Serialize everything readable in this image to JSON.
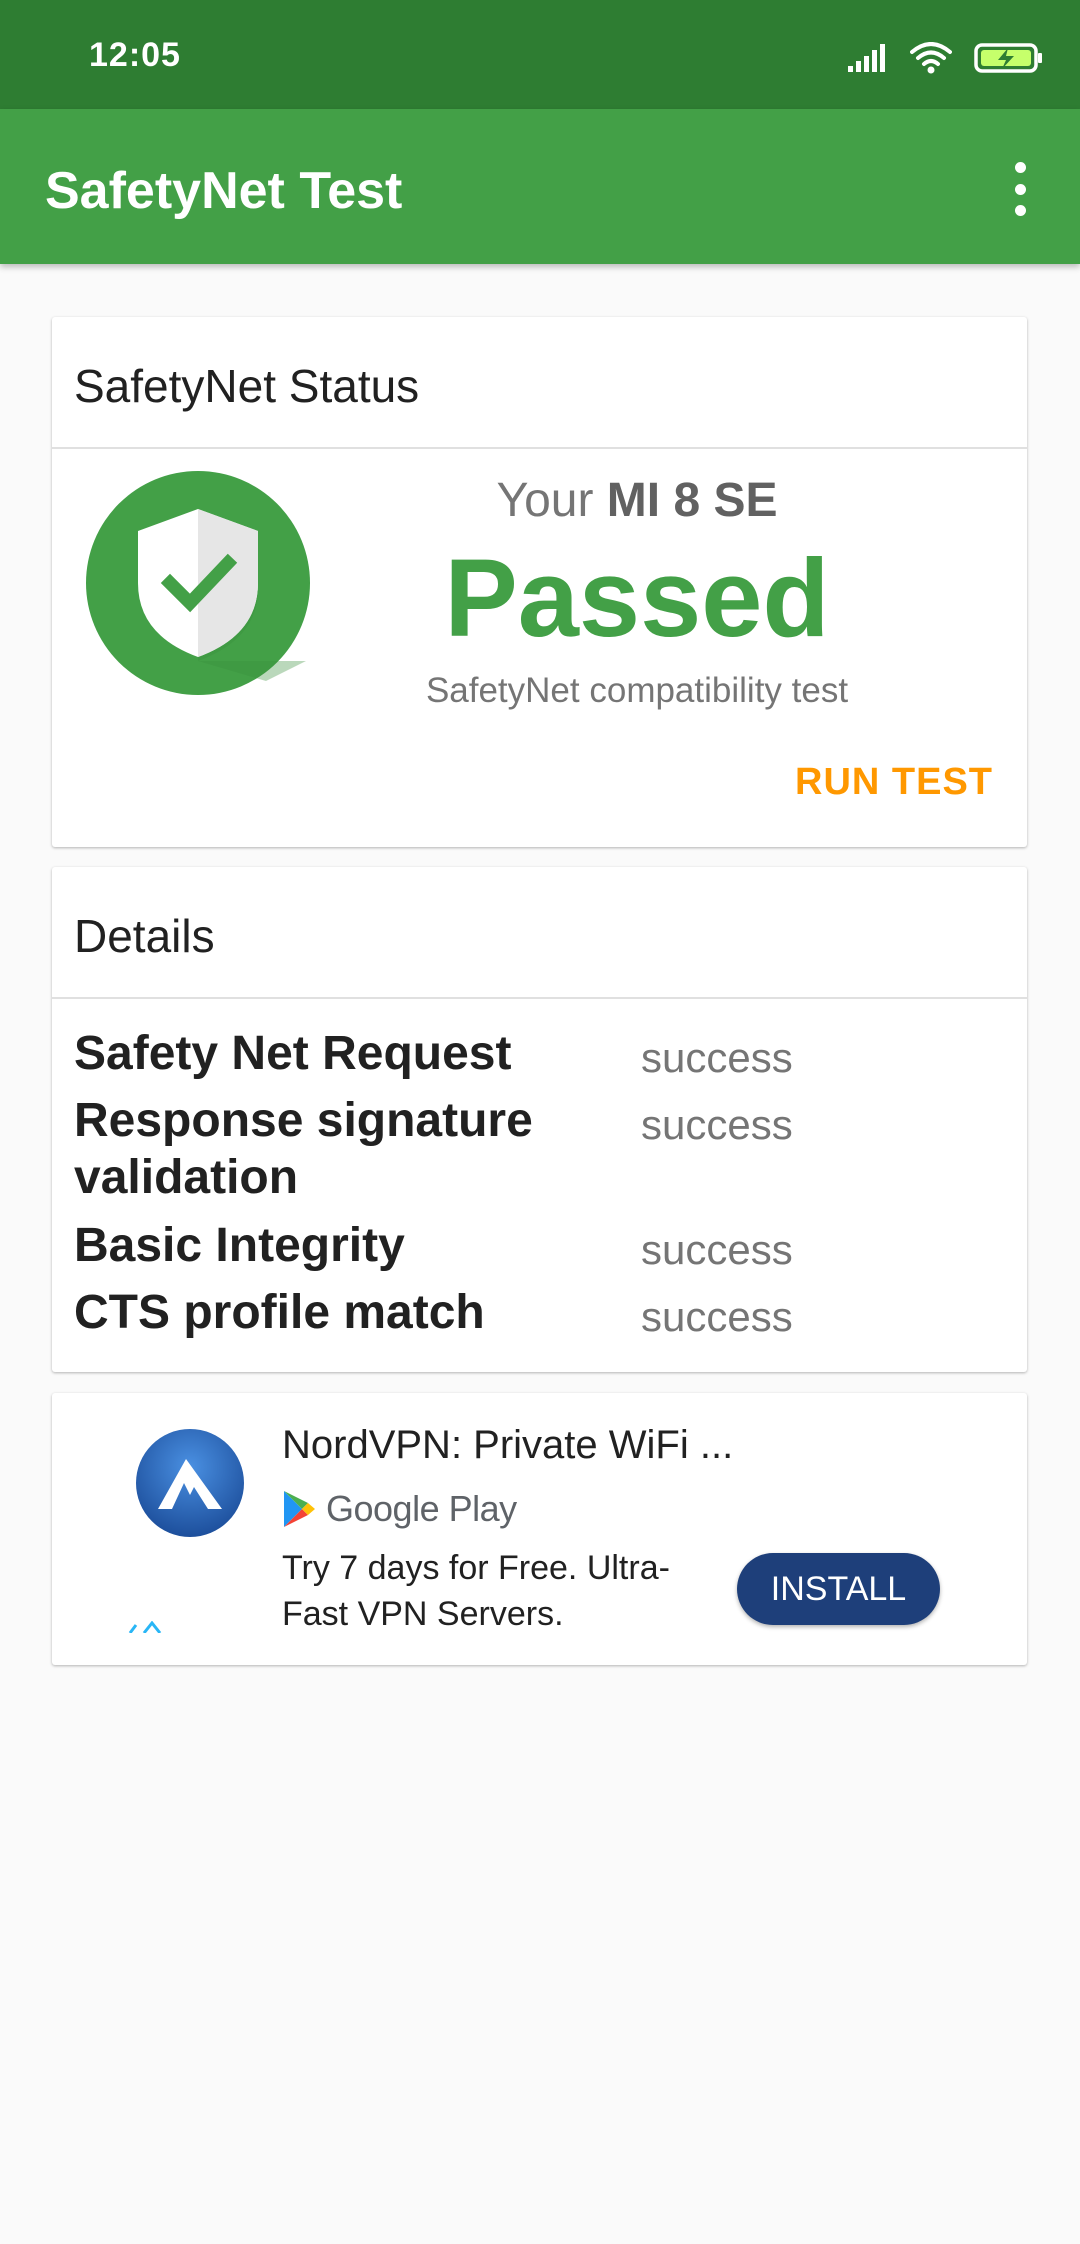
{
  "status_bar": {
    "time": "12:05",
    "icons": [
      "signal-icon",
      "wifi-icon",
      "battery-charging-icon"
    ]
  },
  "app_bar": {
    "title": "SafetyNet Test",
    "menu_icon": "more-vert-icon"
  },
  "status_card": {
    "header": "SafetyNet Status",
    "device_prefix": "Your",
    "device_name": "MI 8 SE",
    "result": "Passed",
    "subtitle": "SafetyNet compatibility test",
    "action_label": "RUN TEST",
    "icon": "shield-check-icon"
  },
  "details_card": {
    "header": "Details",
    "rows": [
      {
        "label": "Safety Net Request",
        "value": "success"
      },
      {
        "label": "Response signature validation",
        "value": "success"
      },
      {
        "label": "Basic Integrity",
        "value": "success"
      },
      {
        "label": "CTS profile match",
        "value": "success"
      }
    ]
  },
  "ad": {
    "title": "NordVPN: Private WiFi ...",
    "store": "Google Play",
    "body": "Try 7 days for Free. Ultra-Fast VPN Servers.",
    "button_label": "INSTALL",
    "logo_icon": "nordvpn-logo-icon"
  },
  "colors": {
    "status_bar": "#2e7d32",
    "app_bar": "#43a047",
    "passed": "#43a047",
    "run_test": "#ff9800",
    "install_button": "#1e3f7a"
  }
}
